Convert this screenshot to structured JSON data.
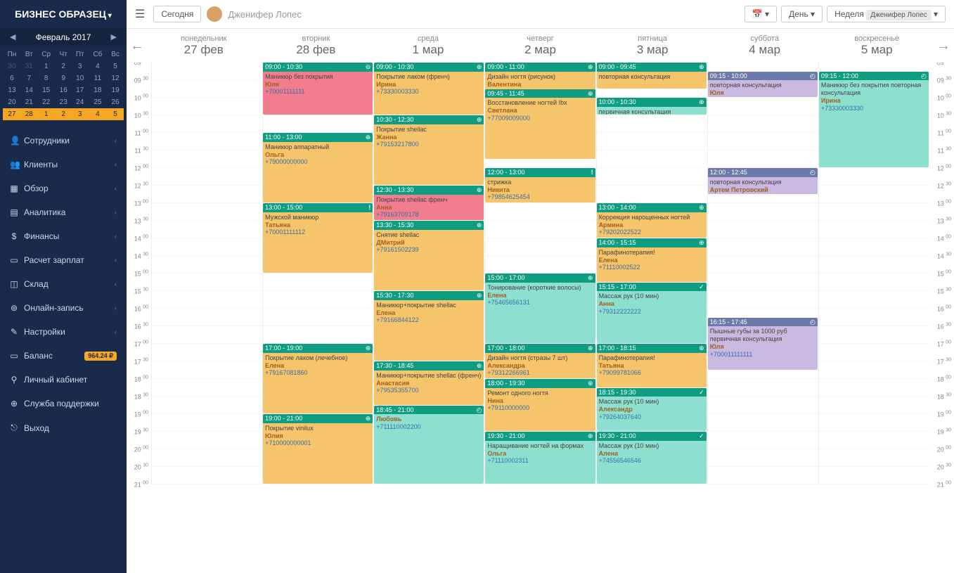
{
  "sidebar": {
    "business_name": "БИЗНЕС ОБРАЗЕЦ",
    "month_label": "Февраль 2017",
    "weekdays": [
      "Пн",
      "Вт",
      "Ср",
      "Чт",
      "Пт",
      "Сб",
      "Вс"
    ],
    "menu": [
      {
        "icon": "👤",
        "label": "Сотрудники",
        "chev": true
      },
      {
        "icon": "👥",
        "label": "Клиенты",
        "chev": true
      },
      {
        "icon": "▦",
        "label": "Обзор",
        "chev": true
      },
      {
        "icon": "▤",
        "label": "Аналитика",
        "chev": true
      },
      {
        "icon": "$",
        "label": "Финансы",
        "chev": true
      },
      {
        "icon": "▭",
        "label": "Расчет зарплат",
        "chev": true
      },
      {
        "icon": "◫",
        "label": "Склад",
        "chev": true
      },
      {
        "icon": "⊚",
        "label": "Онлайн-запись",
        "chev": true
      },
      {
        "icon": "✎",
        "label": "Настройки",
        "chev": true
      },
      {
        "icon": "▭",
        "label": "Баланс",
        "badge": "964.24 ₽"
      },
      {
        "icon": "⚲",
        "label": "Личный кабинет"
      },
      {
        "icon": "⊕",
        "label": "Служба поддержки"
      },
      {
        "icon": "⎋",
        "label": "Выход"
      }
    ]
  },
  "topbar": {
    "today": "Сегодня",
    "user": "Дженифер Лопес",
    "day": "День",
    "week": "Неделя",
    "tag": "Дженифер Лопес"
  },
  "days": [
    {
      "dow": "понедельник",
      "date": "27 фев"
    },
    {
      "dow": "вторник",
      "date": "28 фев"
    },
    {
      "dow": "среда",
      "date": "1 мар"
    },
    {
      "dow": "четверг",
      "date": "2 мар"
    },
    {
      "dow": "пятница",
      "date": "3 мар"
    },
    {
      "dow": "суббота",
      "date": "4 мар"
    },
    {
      "dow": "воскресенье",
      "date": "5 мар"
    }
  ],
  "time_start": 9,
  "time_end": 21,
  "events": [
    {
      "day": 1,
      "start": 9,
      "end": 10.5,
      "color": "pink",
      "time": "09:00 - 10:30",
      "icon": "minus",
      "title": "Маникюр без покрытия",
      "name": "Юля",
      "phone": "+70001111111"
    },
    {
      "day": 1,
      "start": 11,
      "end": 13,
      "color": "orange",
      "time": "11:00 - 13:00",
      "icon": "plus",
      "title": "Маникюр аппаратный",
      "name": "Ольга",
      "phone": "+79000000000"
    },
    {
      "day": 1,
      "start": 13,
      "end": 15,
      "color": "orange",
      "time": "13:00 - 15:00",
      "icon": "excl",
      "title": "Мужской маникюр",
      "name": "Татьяна",
      "phone": "+70001111112"
    },
    {
      "day": 1,
      "start": 17,
      "end": 19,
      "color": "orange",
      "time": "17:00 - 19:00",
      "icon": "plus",
      "title": "Покрытие лаком (лечебное)",
      "name": "Елена",
      "phone": "+79167081860"
    },
    {
      "day": 1,
      "start": 19,
      "end": 21,
      "color": "orange",
      "time": "19:00 - 21:00",
      "icon": "plus",
      "title": "Покрытие vinilux",
      "name": "Юлия",
      "phone": "+710000000001"
    },
    {
      "day": 2,
      "start": 9,
      "end": 10.5,
      "color": "orange",
      "time": "09:00 - 10:30",
      "icon": "plus",
      "title": "Покрытие лаком (френч)",
      "name": "Ирина",
      "phone": "+73330003330"
    },
    {
      "day": 2,
      "start": 10.5,
      "end": 12.5,
      "color": "orange",
      "time": "10:30 - 12:30",
      "icon": "plus",
      "title": "Покрытие shellac",
      "name": "Жанна",
      "phone": "+79153217800"
    },
    {
      "day": 2,
      "start": 12.5,
      "end": 13.5,
      "color": "pink",
      "time": "12:30 - 13:30",
      "icon": "plus",
      "title": "Покрытие shellac френч",
      "name": "Анна",
      "phone": "+79163709178"
    },
    {
      "day": 2,
      "start": 13.5,
      "end": 15.5,
      "color": "orange",
      "time": "13:30 - 15:30",
      "icon": "plus",
      "title": "Снятие shellac",
      "name": "ДМитрий",
      "phone": "+79161502239"
    },
    {
      "day": 2,
      "start": 15.5,
      "end": 17.5,
      "color": "orange",
      "time": "15:30 - 17:30",
      "icon": "plus",
      "title": "Маникюр+покрытие shellac",
      "name": "Елена",
      "phone": "+79166844122"
    },
    {
      "day": 2,
      "start": 17.5,
      "end": 18.75,
      "color": "orange",
      "time": "17:30 - 18:45",
      "icon": "plus",
      "title": "Маникюр+покрытие shellac (френч)",
      "name": "Анастасия",
      "phone": "+79535355700"
    },
    {
      "day": 2,
      "start": 18.75,
      "end": 21,
      "color": "teal",
      "time": "18:45 - 21:00",
      "icon": "clock",
      "title": "",
      "name": "Любовь",
      "phone": "+711110002200"
    },
    {
      "day": 3,
      "start": 9,
      "end": 10.4,
      "color": "orange",
      "time": "09:00 - 11:00",
      "icon": "plus",
      "title": "Дизайн ногтя (рисунок)",
      "name": "Валентина",
      "phone": ""
    },
    {
      "day": 3,
      "start": 9.75,
      "end": 11.75,
      "color": "orange",
      "time": "09:45 - 11:45",
      "icon": "plus",
      "title": "Восстановление ногтей Ibx",
      "name": "Светлана",
      "phone": "+77009009000"
    },
    {
      "day": 3,
      "start": 12,
      "end": 13,
      "color": "orange",
      "time": "12:00 - 13:00",
      "icon": "excl",
      "title": "стрижка",
      "name": "Никита",
      "phone": "+79854625454"
    },
    {
      "day": 3,
      "start": 15,
      "end": 17,
      "color": "teal",
      "time": "15:00 - 17:00",
      "icon": "plus",
      "title": "Тонирование (короткие волосы)",
      "name": "Елена",
      "phone": "+75465656131"
    },
    {
      "day": 3,
      "start": 17,
      "end": 18,
      "color": "orange",
      "time": "17:00 - 18:00",
      "icon": "plus",
      "title": "Дизайн ногтя (стразы 7 шт)",
      "name": "Александра",
      "phone": "+79312266961"
    },
    {
      "day": 3,
      "start": 18,
      "end": 19.5,
      "color": "orange",
      "time": "18:00 - 19:30",
      "icon": "plus",
      "title": "Ремонт одного ногтя",
      "name": "Нина",
      "phone": "+79110000000"
    },
    {
      "day": 3,
      "start": 19.5,
      "end": 21,
      "color": "teal",
      "time": "19:30 - 21:00",
      "icon": "plus",
      "title": "Наращивание ногтей на формах",
      "name": "Ольга",
      "phone": "+71110002311"
    },
    {
      "day": 4,
      "start": 9,
      "end": 9.75,
      "color": "orange",
      "time": "09:00 - 09:45",
      "icon": "plus",
      "title": "повторная консультация",
      "name": "",
      "phone": ""
    },
    {
      "day": 4,
      "start": 10,
      "end": 10.5,
      "color": "teal",
      "time": "10:00 - 10:30",
      "icon": "plus",
      "title": "первичная консультация",
      "name": "",
      "phone": ""
    },
    {
      "day": 4,
      "start": 13,
      "end": 14,
      "color": "orange",
      "time": "13:00 - 14:00",
      "icon": "plus",
      "title": "Коррекция нарощенных ногтей",
      "name": "Армина",
      "phone": "+79202022522"
    },
    {
      "day": 4,
      "start": 14,
      "end": 15.25,
      "color": "orange",
      "time": "14:00 - 15:15",
      "icon": "plus",
      "title": "Парафинотерапия!",
      "name": "Елена",
      "phone": "+71110002522"
    },
    {
      "day": 4,
      "start": 15.25,
      "end": 17,
      "color": "teal",
      "time": "15:15 - 17:00",
      "icon": "check",
      "title": "Массаж рук (10 мин)",
      "name": "Анна",
      "phone": "+79312222222"
    },
    {
      "day": 4,
      "start": 17,
      "end": 18.25,
      "color": "orange",
      "time": "17:00 - 18:15",
      "icon": "plus",
      "title": "Парафинотерапия!",
      "name": "Татьяна",
      "phone": "+79099781066"
    },
    {
      "day": 4,
      "start": 18.25,
      "end": 19.5,
      "color": "teal",
      "time": "18:15 - 19:30",
      "icon": "check",
      "title": "Массаж рук (10 мин)",
      "name": "Александр",
      "phone": "+79264037640"
    },
    {
      "day": 4,
      "start": 19.5,
      "end": 21,
      "color": "teal",
      "time": "19:30 - 21:00",
      "icon": "check",
      "title": "Массаж рук (10 мин)",
      "name": "Алена",
      "phone": "+74556546546"
    },
    {
      "day": 5,
      "start": 9.25,
      "end": 10,
      "color": "purple",
      "time": "09:15 - 10:00",
      "icon": "clock",
      "title": "повторная консультация",
      "name": "Юля",
      "phone": ""
    },
    {
      "day": 5,
      "start": 12,
      "end": 12.75,
      "color": "purple",
      "time": "12:00 - 12:45",
      "icon": "clock",
      "title": "повторная консультация",
      "name": "Артем Петровский",
      "phone": ""
    },
    {
      "day": 5,
      "start": 16.25,
      "end": 17.75,
      "color": "purple",
      "time": "16:15 - 17:45",
      "icon": "clock",
      "title": "Пышные губы за 1000 руб  первичная консультация",
      "name": "Юля",
      "phone": "+700011111111"
    },
    {
      "day": 6,
      "start": 9.25,
      "end": 12,
      "color": "teal",
      "time": "09:15 - 12:00",
      "icon": "clock",
      "title": "Маникюр без покрытия  повторная консультация",
      "name": "Ирина",
      "phone": "+73330003330"
    }
  ],
  "mini_cal": [
    [
      {
        "d": 30,
        "o": 1
      },
      {
        "d": 31,
        "o": 1
      },
      {
        "d": 1
      },
      {
        "d": 2
      },
      {
        "d": 3
      },
      {
        "d": 4
      },
      {
        "d": 5
      }
    ],
    [
      {
        "d": 6
      },
      {
        "d": 7
      },
      {
        "d": 8
      },
      {
        "d": 9
      },
      {
        "d": 10
      },
      {
        "d": 11
      },
      {
        "d": 12
      }
    ],
    [
      {
        "d": 13
      },
      {
        "d": 14
      },
      {
        "d": 15
      },
      {
        "d": 16
      },
      {
        "d": 17
      },
      {
        "d": 18
      },
      {
        "d": 19
      }
    ],
    [
      {
        "d": 20
      },
      {
        "d": 21
      },
      {
        "d": 22
      },
      {
        "d": 23
      },
      {
        "d": 24
      },
      {
        "d": 25
      },
      {
        "d": 26
      }
    ],
    [
      {
        "d": 27
      },
      {
        "d": 28
      },
      {
        "d": 1,
        "o": 1
      },
      {
        "d": 2,
        "o": 1
      },
      {
        "d": 3,
        "o": 1
      },
      {
        "d": 4,
        "o": 1
      },
      {
        "d": 5,
        "o": 1
      }
    ]
  ]
}
